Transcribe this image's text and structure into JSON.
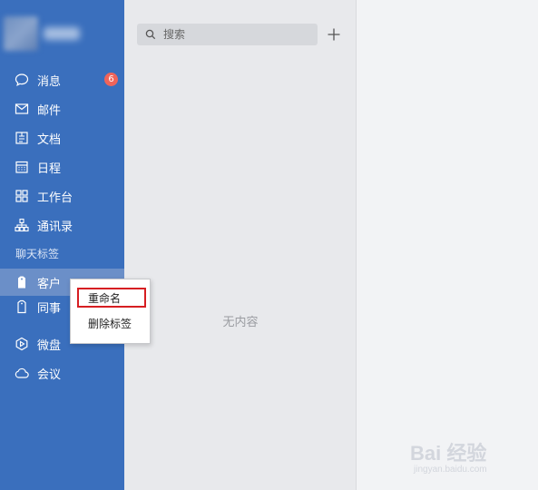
{
  "sidebar": {
    "items": [
      {
        "label": "消息",
        "icon": "chat-bubble-icon",
        "badge": "6"
      },
      {
        "label": "邮件",
        "icon": "mail-icon"
      },
      {
        "label": "文档",
        "icon": "document-icon"
      },
      {
        "label": "日程",
        "icon": "calendar-icon"
      },
      {
        "label": "工作台",
        "icon": "grid-icon"
      },
      {
        "label": "通讯录",
        "icon": "org-chart-icon"
      }
    ],
    "section_label": "聊天标签",
    "tags": [
      {
        "label": "客户",
        "icon": "tag-icon",
        "selected": true
      },
      {
        "label": "同事",
        "icon": "tag-outline-icon"
      }
    ],
    "bottom_items": [
      {
        "label": "微盘",
        "icon": "drive-icon"
      },
      {
        "label": "会议",
        "icon": "cloud-icon"
      }
    ]
  },
  "search": {
    "placeholder": "搜索"
  },
  "main": {
    "empty_text": "无内容"
  },
  "context_menu": {
    "items": [
      {
        "label": "重命名",
        "highlighted": true
      },
      {
        "label": "删除标签"
      }
    ]
  },
  "watermark": {
    "title": "Bai 经验",
    "sub": "jingyan.baidu.com"
  },
  "colors": {
    "sidebar": "#3a6fbd",
    "badge": "#f0645a",
    "highlight_border": "#d61e22"
  }
}
